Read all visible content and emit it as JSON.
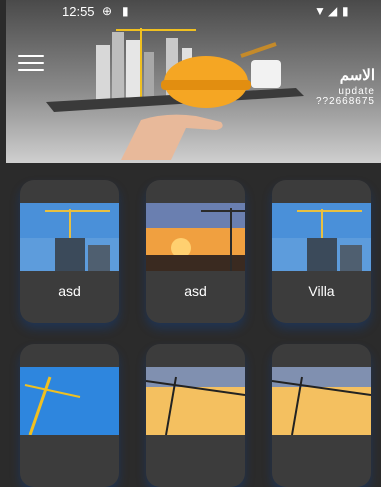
{
  "status_bar": {
    "time": "12:55"
  },
  "header": {
    "menu_icon": "hamburger-menu-icon",
    "profile_name": "الاسم",
    "profile_update": "update",
    "profile_phone": "??2668675"
  },
  "categories": [
    {
      "label": "asd",
      "image": "crane-building-blue-sky"
    },
    {
      "label": "asd",
      "image": "crane-construction-sunset"
    },
    {
      "label": "Villa",
      "image": "crane-building-blue-sky"
    },
    {
      "label": "",
      "image": "crane-blue-sky"
    },
    {
      "label": "",
      "image": "crane-sunset"
    },
    {
      "label": "",
      "image": "crane-sunset"
    }
  ]
}
